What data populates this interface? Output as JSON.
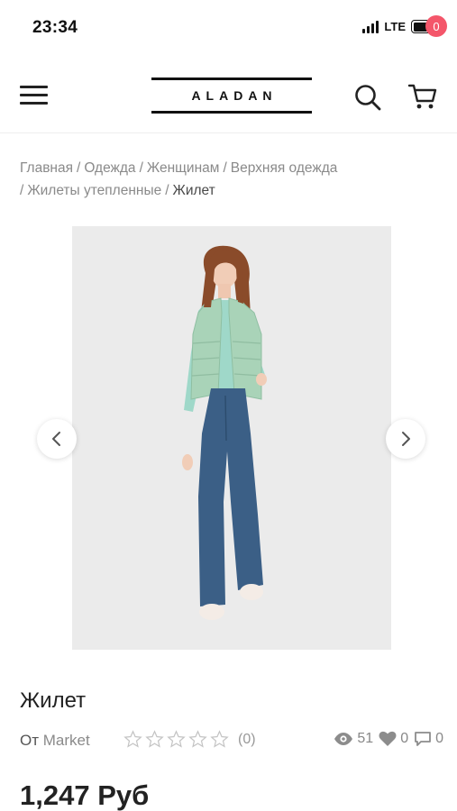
{
  "status_bar": {
    "time": "23:34",
    "network": "LTE"
  },
  "header": {
    "logo": "ALADAN",
    "cart_count": "0"
  },
  "breadcrumb": [
    "Главная",
    "Одежда",
    "Женщинам",
    "Верхняя одежда",
    "Жилеты утепленные",
    "Жилет"
  ],
  "product": {
    "title": "Жилет",
    "seller_prefix": "От",
    "seller_name": "Market",
    "rating_stars": 0,
    "rating_max": 5,
    "rating_count": "(0)",
    "views": "51",
    "likes": "0",
    "comments": "0",
    "price": "1,247 Руб"
  },
  "colors": {
    "badge": "#f4566a",
    "gallery_bg": "#ebebeb",
    "vest": "#a9d3b8",
    "jeans": "#3b5f86"
  },
  "icons": [
    "menu-icon",
    "search-icon",
    "cart-icon",
    "chevron-left-icon",
    "chevron-right-icon",
    "star-icon",
    "eye-icon",
    "heart-icon",
    "comment-icon"
  ]
}
